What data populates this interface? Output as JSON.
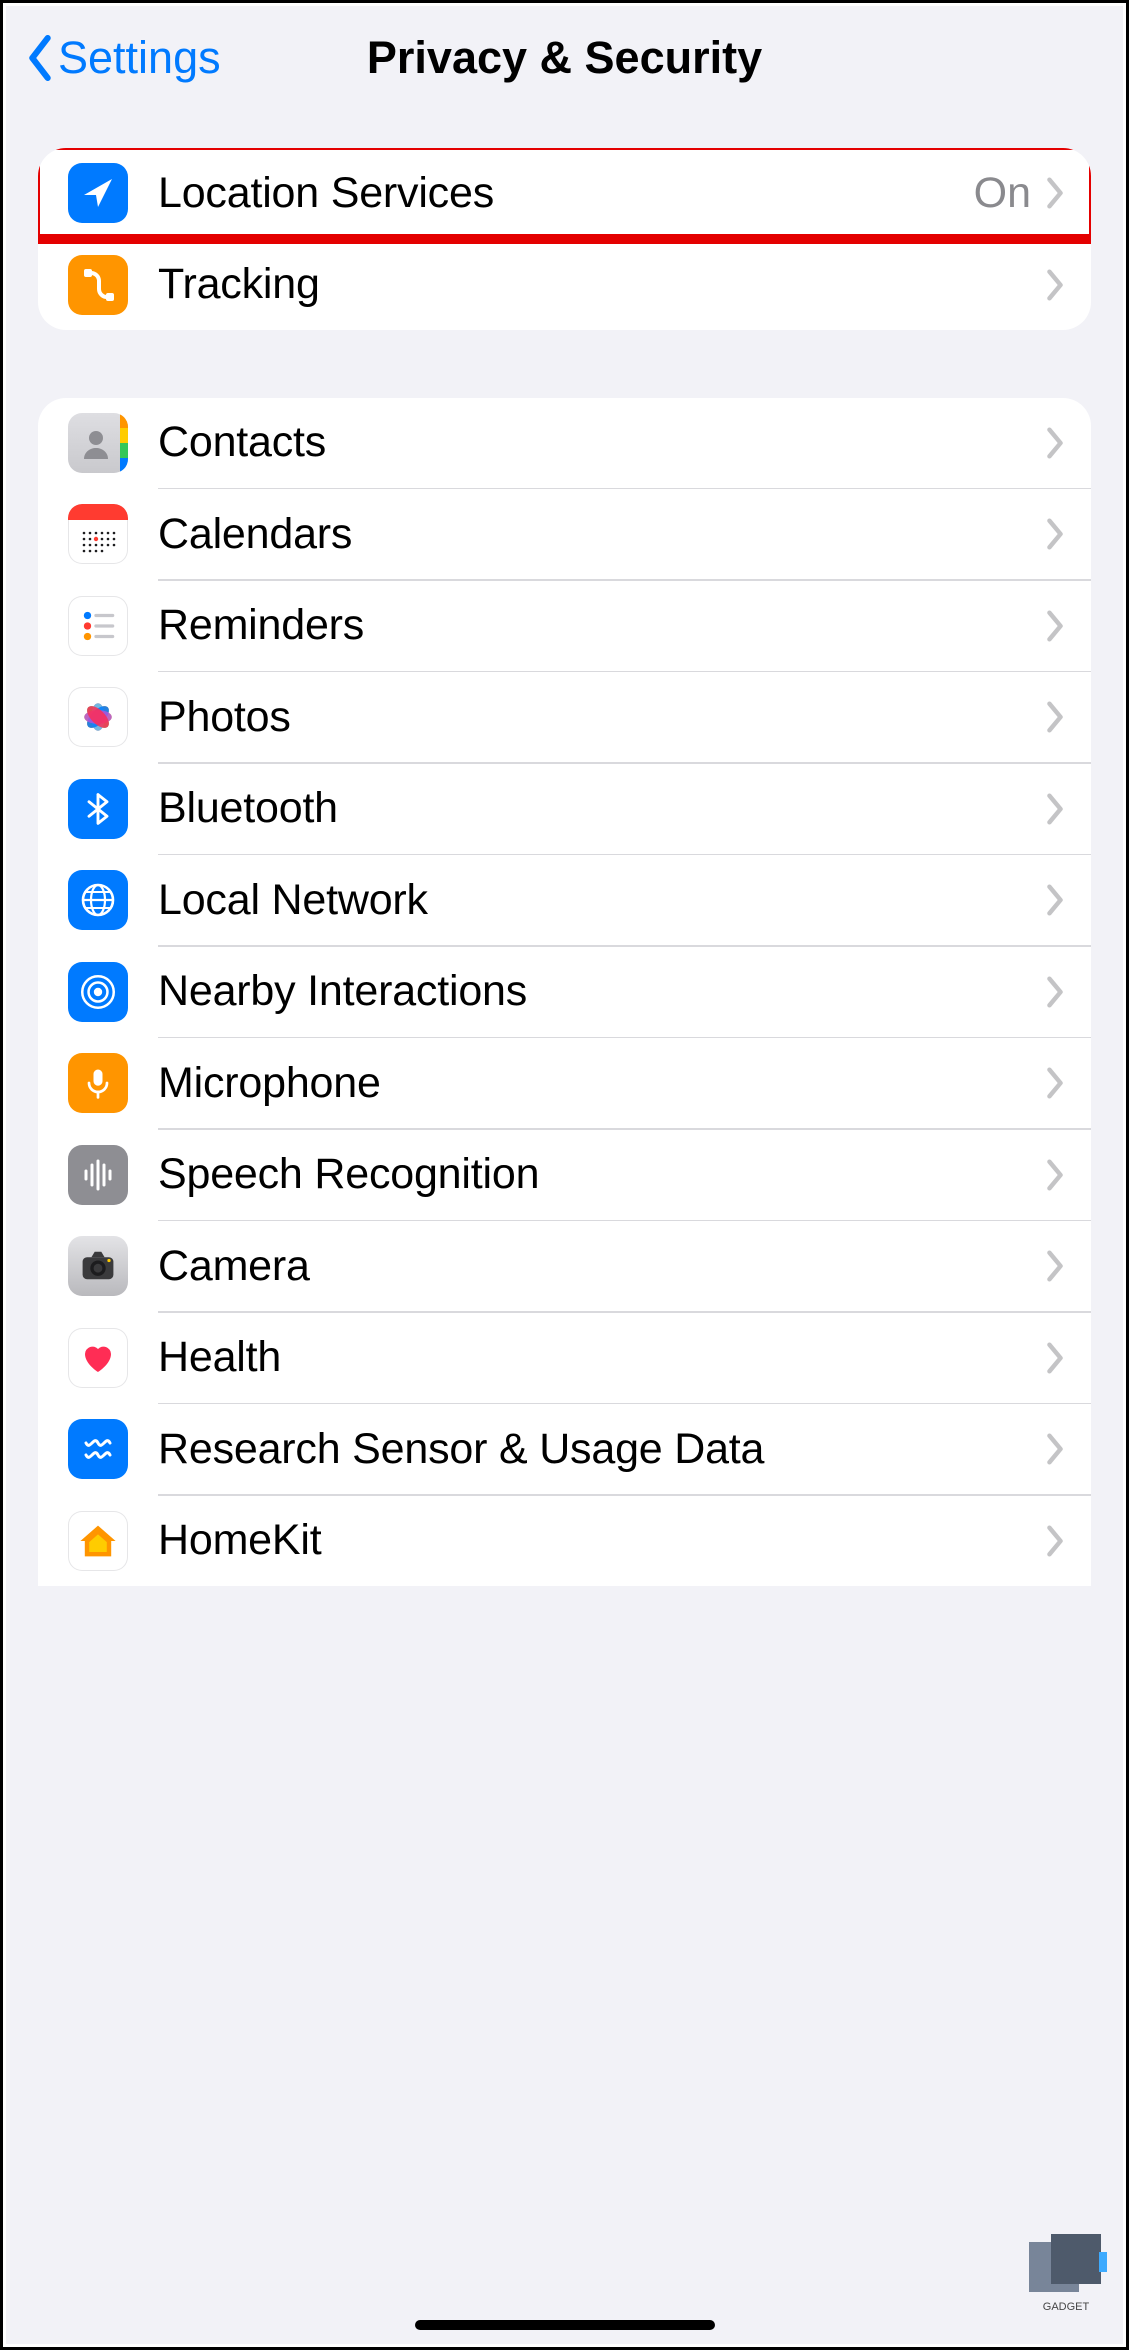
{
  "nav": {
    "back_label": "Settings",
    "title": "Privacy & Security"
  },
  "group1": [
    {
      "id": "location-services",
      "label": "Location Services",
      "value": "On",
      "icon": "location-arrow-icon",
      "bg": "bg-blue",
      "highlighted": true
    },
    {
      "id": "tracking",
      "label": "Tracking",
      "value": "",
      "icon": "tracking-path-icon",
      "bg": "bg-orange"
    }
  ],
  "group2": [
    {
      "id": "contacts",
      "label": "Contacts",
      "icon": "contacts-icon",
      "bg": "bg-lgray"
    },
    {
      "id": "calendars",
      "label": "Calendars",
      "icon": "calendar-icon",
      "bg": "bg-white"
    },
    {
      "id": "reminders",
      "label": "Reminders",
      "icon": "reminders-icon",
      "bg": "bg-white"
    },
    {
      "id": "photos",
      "label": "Photos",
      "icon": "photos-flower-icon",
      "bg": "bg-white"
    },
    {
      "id": "bluetooth",
      "label": "Bluetooth",
      "icon": "bluetooth-icon",
      "bg": "bg-blue"
    },
    {
      "id": "local-network",
      "label": "Local Network",
      "icon": "globe-icon",
      "bg": "bg-blue"
    },
    {
      "id": "nearby-interactions",
      "label": "Nearby Interactions",
      "icon": "nearby-radar-icon",
      "bg": "bg-blue"
    },
    {
      "id": "microphone",
      "label": "Microphone",
      "icon": "microphone-icon",
      "bg": "bg-orange"
    },
    {
      "id": "speech-recognition",
      "label": "Speech Recognition",
      "icon": "waveform-icon",
      "bg": "bg-speech"
    },
    {
      "id": "camera",
      "label": "Camera",
      "icon": "camera-icon",
      "bg": "bg-cam"
    },
    {
      "id": "health",
      "label": "Health",
      "icon": "heart-icon",
      "bg": "bg-white"
    },
    {
      "id": "research-sensor",
      "label": "Research Sensor & Usage Data",
      "icon": "research-icon",
      "bg": "bg-blue"
    },
    {
      "id": "homekit",
      "label": "HomeKit",
      "icon": "home-icon",
      "bg": "bg-white"
    }
  ],
  "watermark_text": "GADGET"
}
